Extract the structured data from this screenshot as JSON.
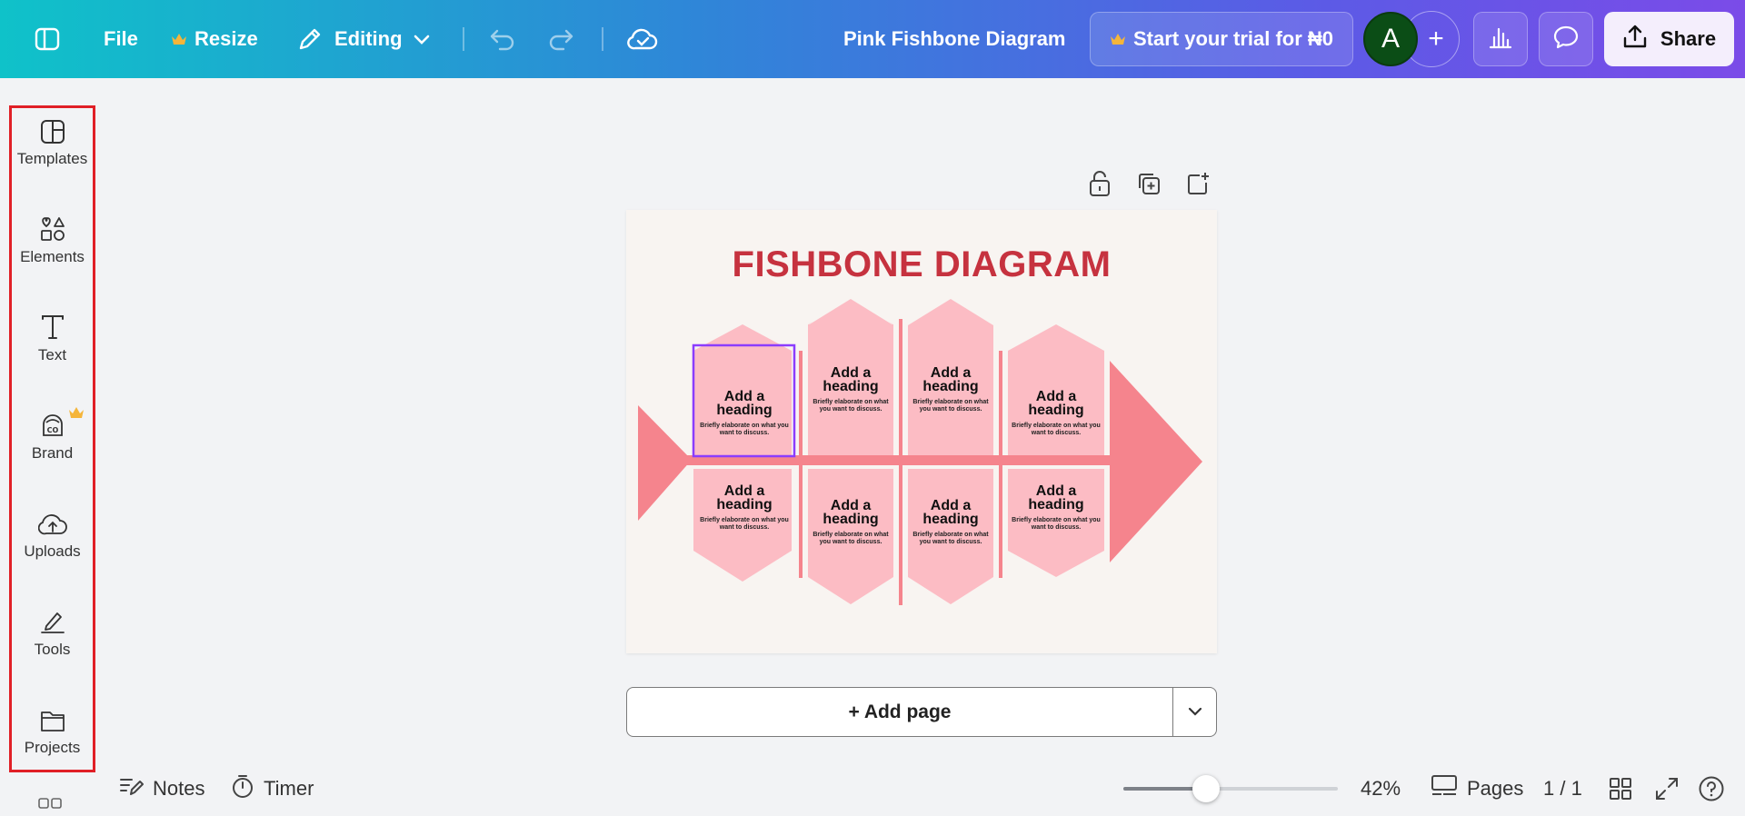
{
  "topbar": {
    "file_label": "File",
    "resize_label": "Resize",
    "editing_label": "Editing",
    "doc_title": "Pink Fishbone Diagram",
    "trial_label": "Start your trial for ₦0",
    "avatar_letter": "A",
    "share_label": "Share"
  },
  "sidebar": {
    "items": [
      {
        "label": "Templates",
        "icon": "templates-icon"
      },
      {
        "label": "Elements",
        "icon": "elements-icon"
      },
      {
        "label": "Text",
        "icon": "text-icon"
      },
      {
        "label": "Brand",
        "icon": "brand-icon"
      },
      {
        "label": "Uploads",
        "icon": "uploads-icon"
      },
      {
        "label": "Tools",
        "icon": "tools-icon"
      },
      {
        "label": "Projects",
        "icon": "projects-icon"
      }
    ]
  },
  "diagram": {
    "title": "FISHBONE DIAGRAM",
    "cards": [
      {
        "heading": "Add a heading",
        "body": "Briefly elaborate on what you want to discuss."
      },
      {
        "heading": "Add a heading",
        "body": "Briefly elaborate on what you want to discuss."
      },
      {
        "heading": "Add a heading",
        "body": "Briefly elaborate on what you want to discuss."
      },
      {
        "heading": "Add a heading",
        "body": "Briefly elaborate on what you want to discuss."
      },
      {
        "heading": "Add a heading",
        "body": "Briefly elaborate on what you want to discuss."
      },
      {
        "heading": "Add a heading",
        "body": "Briefly elaborate on what you want to discuss."
      },
      {
        "heading": "Add a heading",
        "body": "Briefly elaborate on what you want to discuss."
      },
      {
        "heading": "Add a heading",
        "body": "Briefly elaborate on what you want to discuss."
      }
    ]
  },
  "add_page_label": "+ Add page",
  "bottombar": {
    "notes_label": "Notes",
    "timer_label": "Timer",
    "zoom_percent": "42%",
    "pages_label": "Pages",
    "page_count": "1 / 1"
  },
  "colors": {
    "accent_red": "#c6323f",
    "fish_pink": "#f5848d",
    "card_pink": "#fcbcc4",
    "selection": "#8b3dff",
    "sidebar_outline": "#e01f26"
  }
}
